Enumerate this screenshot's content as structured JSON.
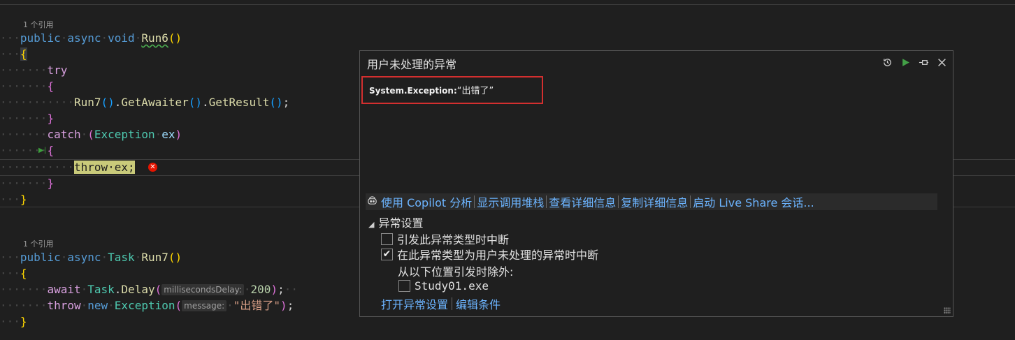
{
  "code": {
    "codelens_1": "1 个引用",
    "codelens_2": "1 个引用",
    "lines": {
      "l1": {
        "kw1": "public",
        "kw2": "async",
        "kw3": "void",
        "fn": "Run6",
        "parens": "()"
      },
      "l2": {
        "brace": "{"
      },
      "l3": {
        "kw": "try"
      },
      "l4": {
        "brace": "{"
      },
      "l5": {
        "fn1": "Run7",
        "p1": "()",
        "dot1": ".",
        "fn2": "GetAwaiter",
        "p2": "()",
        "dot2": ".",
        "fn3": "GetResult",
        "p3": "()",
        "semi": ";"
      },
      "l6": {
        "brace": "}"
      },
      "l7": {
        "kw": "catch",
        "open": "(",
        "type": "Exception",
        "var": "ex",
        "close": ")"
      },
      "l8": {
        "brace": "{"
      },
      "l9": {
        "kw": "throw",
        "var": "ex",
        "semi": ";"
      },
      "l10": {
        "brace": "}"
      },
      "l11": {
        "brace": "}"
      },
      "l12": {
        "kw1": "public",
        "kw2": "async",
        "type": "Task",
        "fn": "Run7",
        "parens": "()"
      },
      "l13": {
        "brace": "{"
      },
      "l14": {
        "kw": "await",
        "type": "Task",
        "dot": ".",
        "fn": "Delay",
        "open": "(",
        "hint": "millisecondsDelay:",
        "num": "200",
        "close": ")",
        "semi": ";"
      },
      "l15": {
        "kw1": "throw",
        "kw2": "new",
        "type": "Exception",
        "open": "(",
        "hint": "message:",
        "str": "\"出错了\"",
        "close": ")",
        "semi": ";"
      },
      "l16": {
        "brace": "}"
      }
    }
  },
  "popup": {
    "title": "用户未处理的异常",
    "exception_type": "System.Exception:",
    "exception_message": "“出错了”",
    "actions": {
      "copilot": "使用 Copilot 分析",
      "call_stack": "显示调用堆栈",
      "view_details": "查看详细信息",
      "copy_details": "复制详细信息",
      "live_share": "启动 Live Share 会话..."
    },
    "settings": {
      "header": "异常设置",
      "break_when_thrown": {
        "label": "引发此异常类型时中断",
        "checked": false
      },
      "break_when_unhandled": {
        "label": "在此异常类型为用户未处理的异常时中断",
        "checked": true
      },
      "except_label": "从以下位置引发时除外:",
      "module": {
        "label": "Study01.exe",
        "checked": false
      }
    },
    "links": {
      "open_settings": "打开异常设置",
      "edit_conditions": "编辑条件"
    }
  },
  "icons": {
    "history": "history-icon",
    "continue": "play-icon",
    "pin": "pin-icon",
    "close": "close-icon",
    "error": "error-icon",
    "copilot": "copilot-icon",
    "checkmark": "checkmark-icon"
  },
  "colors": {
    "background": "#1f1f1f",
    "keyword": "#569cd6",
    "control_keyword": "#d8a0df",
    "function": "#dcdcaa",
    "type": "#4ec9b0",
    "variable": "#9cdcfe",
    "string": "#d69d85",
    "link": "#6cb4ff",
    "highlight_box": "#d32f2f",
    "current_statement": "#c9ca7a"
  }
}
